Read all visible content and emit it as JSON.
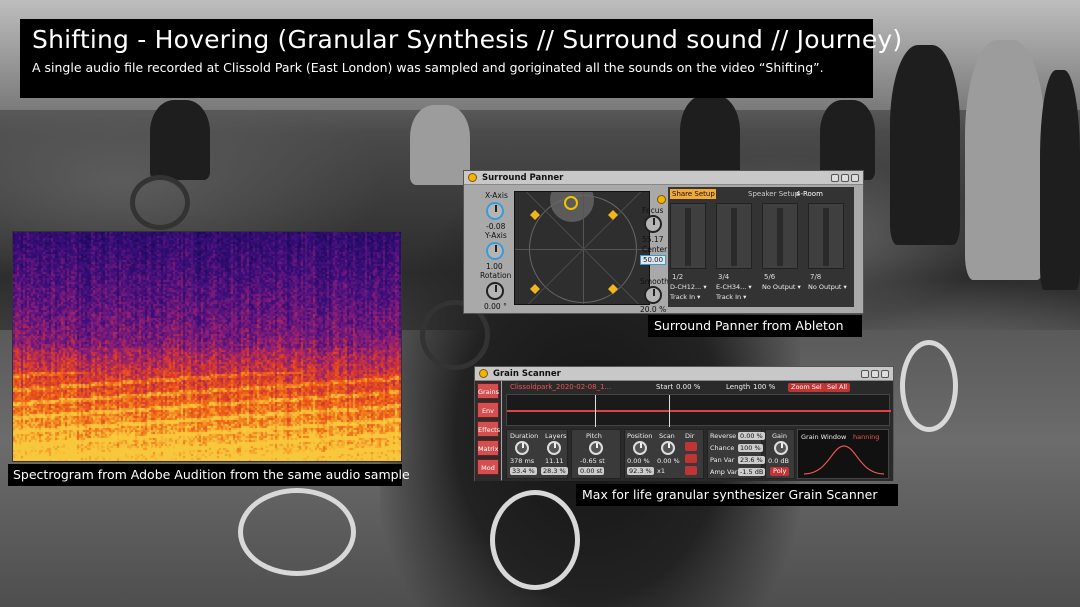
{
  "banner": {
    "title": "Shifting - Hovering (Granular Synthesis  // Surround sound // Journey)",
    "subtitle": "A single audio file recorded at Clissold Park (East London) was sampled and goriginated all the sounds on the video “Shifting”."
  },
  "captions": {
    "spectrogram": "Spectrogram from Adobe Audition from the same audio sample",
    "surround_panner": "Surround Panner from Ableton",
    "grain_scanner": "Max for life  granular synthesizer Grain Scanner"
  },
  "surround_panner": {
    "title": "Surround Panner",
    "x_axis_label": "X-Axis",
    "x_axis_value": "-0.08",
    "y_axis_label": "Y-Axis",
    "y_axis_value": "1.00",
    "rotation_label": "Rotation",
    "rotation_value": "0.00 °",
    "focus_label": "Focus",
    "focus_value": "55.17",
    "center_label": "Center",
    "center_value": "50.00",
    "smooth_label": "Smooth",
    "smooth_value": "20.0 %",
    "share_setup": "Share Setup",
    "speaker_setup": "Speaker Setup",
    "room": "4-Room",
    "channels": [
      {
        "label": "1/2",
        "output": "D-CH12... ▾",
        "track": "Track In ▾"
      },
      {
        "label": "3/4",
        "output": "E-CH34... ▾",
        "track": "Track In ▾"
      },
      {
        "label": "5/6",
        "output": "No Output ▾",
        "track": ""
      },
      {
        "label": "7/8",
        "output": "No Output ▾",
        "track": ""
      }
    ],
    "accent_color": "#f5b400"
  },
  "grain_scanner": {
    "title": "Grain Scanner",
    "tabs": [
      "Grains",
      "Env",
      "Effects",
      "Matrix",
      "Mod"
    ],
    "file": "Clissoldpark_2020-02-08_1...",
    "start_label": "Start",
    "start_value": "0.00 %",
    "length_label": "Length",
    "length_value": "100 %",
    "zoom_btn": "Zoom Sel",
    "selall_btn": "Sel All",
    "duration_label": "Duration",
    "duration_value": "378 ms",
    "layers_label": "Layers",
    "layers_value": "11.11",
    "duration_pct": "33.4 %",
    "layers_pct": "28.3 %",
    "pitch_label": "Pitch",
    "pitch_value": "-0.65 st",
    "pitch_box": "0.00 st",
    "position_label": "Position",
    "position_value": "0.00 %",
    "position_box": "92.3 %",
    "scan_label": "Scan",
    "scan_value": "0.00 %",
    "scan_box": "x1",
    "dir_label": "Dir",
    "reverse_label": "Reverse",
    "reverse_value": "0.00 %",
    "chance_label": "Chance",
    "chance_value": "100 %",
    "panvar_label": "Pan Var",
    "panvar_value": "23.6 %",
    "ampvar_label": "Amp Var",
    "ampvar_value": "-1.5 dB",
    "gain_label": "Gain",
    "gain_value": "0.0 dB",
    "poly_btn": "Poly",
    "grain_window_label": "Grain Window",
    "grain_window_value": "hanning",
    "accent_color": "#c23434"
  }
}
